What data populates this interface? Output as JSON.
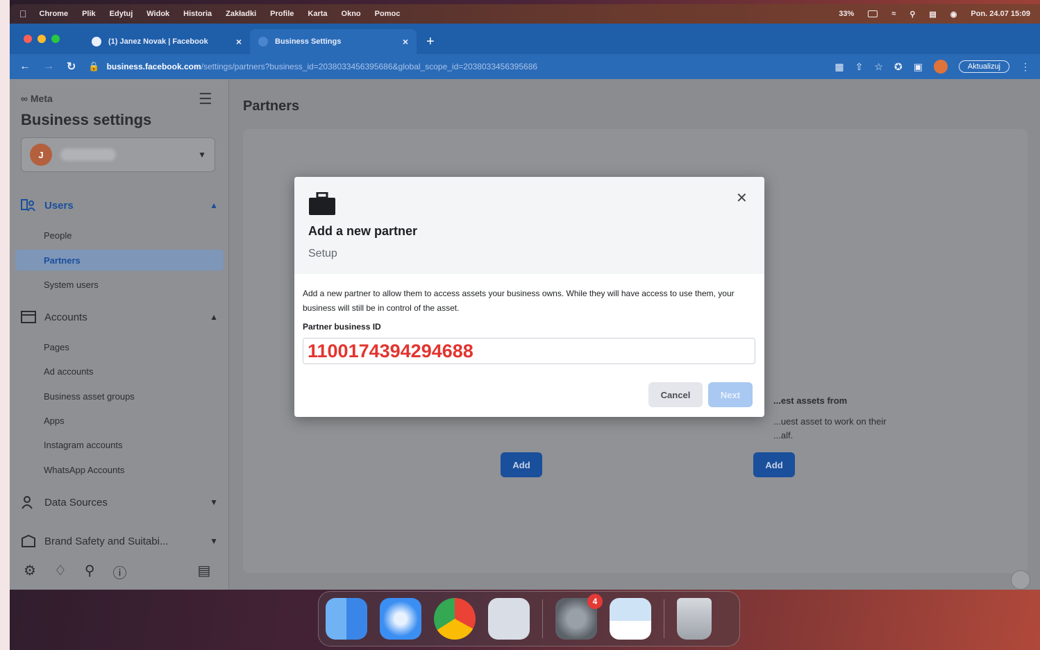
{
  "menubar": {
    "app": "Chrome",
    "items": [
      "Plik",
      "Edytuj",
      "Widok",
      "Historia",
      "Zakładki",
      "Profile",
      "Karta",
      "Okno",
      "Pomoc"
    ],
    "battery": "33%",
    "datetime": "Pon. 24.07  15:09"
  },
  "browser": {
    "tabs": [
      {
        "label": "(1) Janez Novak | Facebook"
      },
      {
        "label": "Business Settings"
      }
    ],
    "url_host": "business.facebook.com",
    "url_path": "/settings/partners?business_id=2038033456395686&global_scope_id=2038033456395686",
    "update_label": "Aktualizuj"
  },
  "sidebar": {
    "logo": "Meta",
    "title": "Business settings",
    "business_initial": "J",
    "groups": [
      {
        "label": "Users",
        "items": [
          "People",
          "Partners",
          "System users"
        ]
      },
      {
        "label": "Accounts",
        "items": [
          "Pages",
          "Ad accounts",
          "Business asset groups",
          "Apps",
          "Instagram accounts",
          "WhatsApp Accounts"
        ]
      },
      {
        "label": "Data Sources"
      },
      {
        "label": "Brand Safety and Suitabi..."
      }
    ]
  },
  "main": {
    "title": "Partners",
    "right_card_title": "...est assets from",
    "right_card_desc": "...uest asset to work on their",
    "right_card_desc2": "...alf.",
    "add_label": "Add"
  },
  "modal": {
    "title": "Add a new partner",
    "subtitle": "Setup",
    "description": "Add a new partner to allow them to access assets your business owns. While they will have access to use them, your business will still be in control of the asset.",
    "field_label": "Partner business ID",
    "field_value": "1100174394294688",
    "cancel_label": "Cancel",
    "next_label": "Next"
  },
  "dock": {
    "settings_badge": "4"
  },
  "colors": {
    "accent": "#1a4f9c",
    "tab_bar": "#1f5ea9",
    "id_highlight": "#e3342f"
  }
}
